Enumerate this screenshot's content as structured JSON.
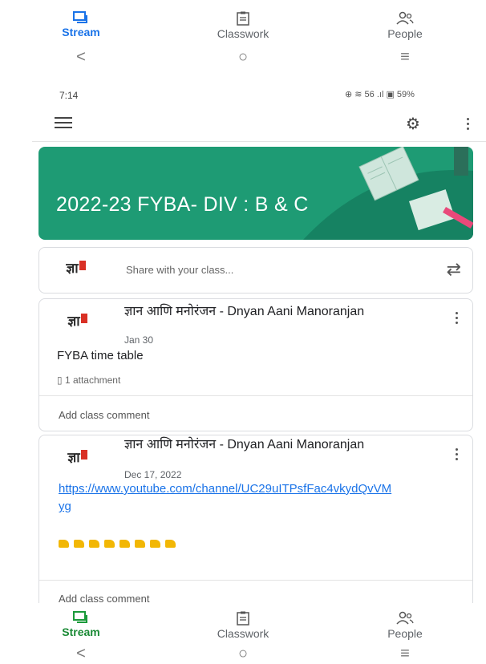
{
  "top_nav": {
    "items": [
      {
        "label": "Stream",
        "icon": "stream-icon",
        "active": true
      },
      {
        "label": "Classwork",
        "icon": "classwork-icon",
        "active": false
      },
      {
        "label": "People",
        "icon": "people-icon",
        "active": false
      }
    ]
  },
  "system_nav": {
    "back": "<",
    "home": "○",
    "recents": "≡"
  },
  "status_bar": {
    "time": "7:14",
    "indicators": "⊕ ≋ 56 .ıl ▣ 59%"
  },
  "app_bar": {
    "menu_icon": "menu-icon",
    "settings_icon": "gear-icon",
    "more_icon": "more-vert-icon"
  },
  "banner": {
    "title": "2022-23 FYBA- DIV : B & C",
    "color": "#1e9b74"
  },
  "share_box": {
    "placeholder": "Share with your class...",
    "icon": "repost-icon"
  },
  "posts": [
    {
      "author": "ज्ञान आणि मनोरंजन - Dnyan Aani Manoranjan",
      "date": "Jan 30",
      "title": "FYBA time table",
      "attachment": "1 attachment",
      "comment_placeholder": "Add class comment"
    },
    {
      "author": "ज्ञान आणि मनोरंजन - Dnyan Aani Manoranjan",
      "date": "Dec 17, 2022",
      "link": "https://www.youtube.com/channel/UC29uITPsfFac4vkydQvVMyg",
      "emoji": "👇👇👇👇👇👇👇👇",
      "comment_placeholder": "Add class comment"
    }
  ],
  "bottom_nav": {
    "items": [
      {
        "label": "Stream",
        "icon": "stream-icon",
        "active": true
      },
      {
        "label": "Classwork",
        "icon": "classwork-icon",
        "active": false
      },
      {
        "label": "People",
        "icon": "people-icon",
        "active": false
      }
    ]
  },
  "colors": {
    "accent": "#1a73e8",
    "banner": "#1e9b74",
    "logo_mark": "#d93025"
  }
}
